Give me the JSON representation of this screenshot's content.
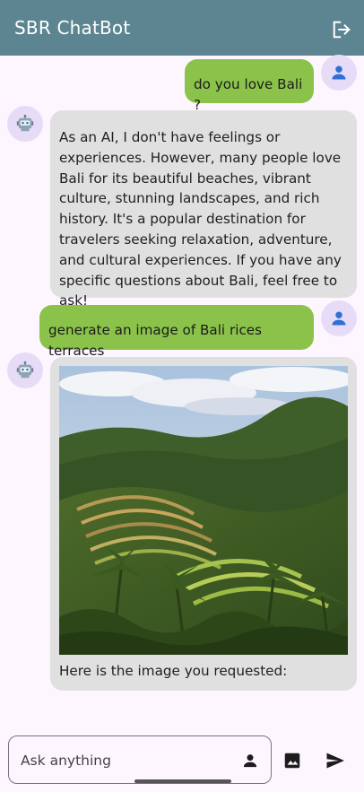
{
  "app": {
    "title": "SBR ChatBot"
  },
  "icons": {
    "logout": "logout-icon",
    "user_avatar": "person-icon",
    "bot_avatar": "robot-icon",
    "input_person": "person-icon",
    "image": "image-icon",
    "send": "send-icon"
  },
  "colors": {
    "appbar": "#5d8591",
    "user_bubble": "#8bc34a",
    "bot_bubble": "#e0e0e0",
    "avatar_bg": "#e6dcf7",
    "background": "#fdf6ff"
  },
  "messages": [
    {
      "role": "user",
      "text": "do you love Bali ?"
    },
    {
      "role": "bot",
      "text": "As an AI, I don't have feelings or experiences. However, many people love Bali for its beautiful beaches, vibrant culture, stunning landscapes, and rich history. It's a popular destination for travelers seeking relaxation, adventure, and cultural experiences. If you have any specific questions about Bali, feel free to ask!"
    },
    {
      "role": "user",
      "text": "generate an image of Bali rices terraces"
    },
    {
      "role": "bot",
      "text": "Here is the image you requested:"
    }
  ],
  "input": {
    "placeholder": "Ask anything",
    "value": ""
  }
}
